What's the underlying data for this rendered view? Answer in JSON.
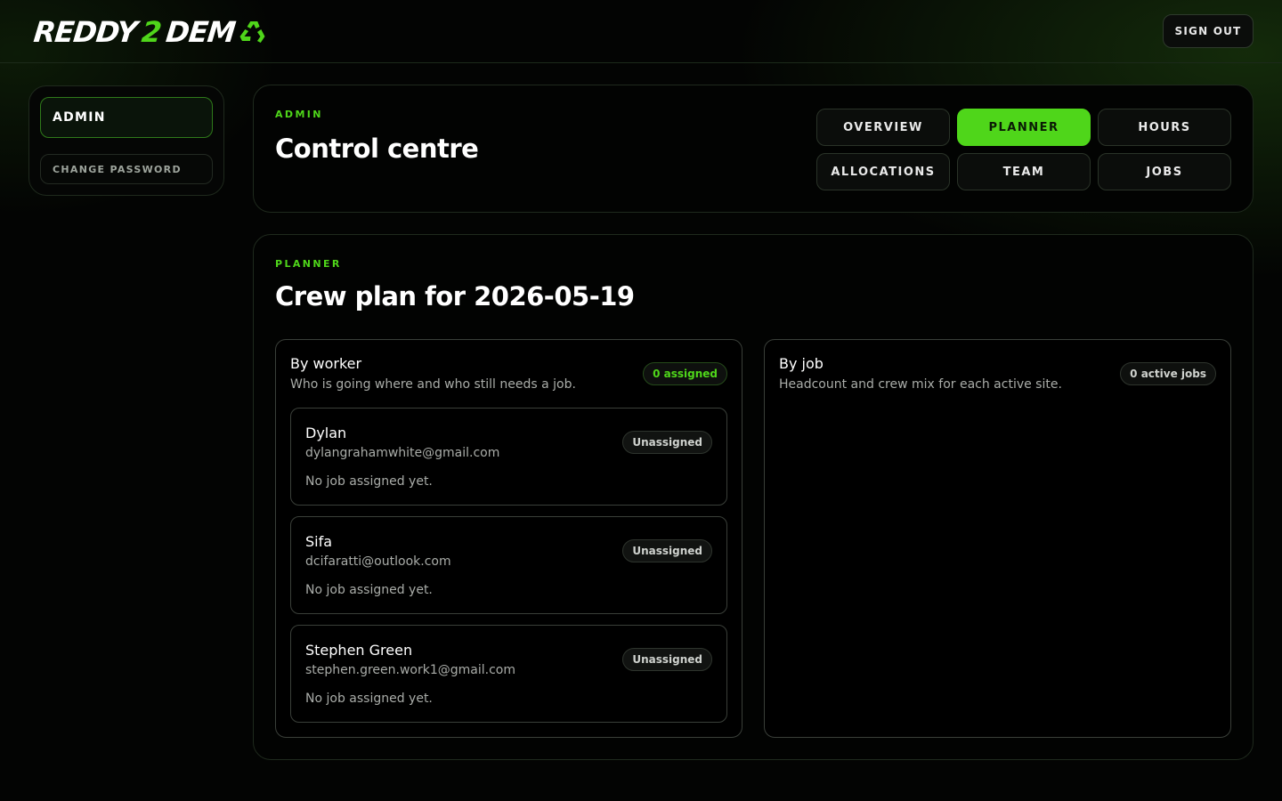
{
  "brand": {
    "logo_text_a": "REDDY",
    "logo_text_b": "2",
    "logo_text_c": "DEM"
  },
  "header": {
    "sign_out_label": "SIGN OUT"
  },
  "sidebar": {
    "items": [
      {
        "label": "ADMIN",
        "active": true
      },
      {
        "label": "CHANGE PASSWORD",
        "active": false
      }
    ]
  },
  "control": {
    "eyebrow": "ADMIN",
    "title": "Control centre",
    "tabs": [
      {
        "label": "OVERVIEW",
        "active": false
      },
      {
        "label": "PLANNER",
        "active": true
      },
      {
        "label": "HOURS",
        "active": false
      },
      {
        "label": "ALLOCATIONS",
        "active": false
      },
      {
        "label": "TEAM",
        "active": false
      },
      {
        "label": "JOBS",
        "active": false
      }
    ]
  },
  "planner": {
    "eyebrow": "PLANNER",
    "title": "Crew plan for 2026-05-19",
    "by_worker": {
      "title": "By worker",
      "subtitle": "Who is going where and who still needs a job.",
      "badge": "0 assigned",
      "workers": [
        {
          "name": "Dylan",
          "email": "dylangrahamwhite@gmail.com",
          "status": "Unassigned",
          "note": "No job assigned yet."
        },
        {
          "name": "Sifa",
          "email": "dcifaratti@outlook.com",
          "status": "Unassigned",
          "note": "No job assigned yet."
        },
        {
          "name": "Stephen Green",
          "email": "stephen.green.work1@gmail.com",
          "status": "Unassigned",
          "note": "No job assigned yet."
        }
      ]
    },
    "by_job": {
      "title": "By job",
      "subtitle": "Headcount and crew mix for each active site.",
      "badge": "0 active jobs"
    }
  },
  "colors": {
    "accent": "#4fd61a",
    "background": "#030403",
    "panel_border": "#3a3f39"
  }
}
